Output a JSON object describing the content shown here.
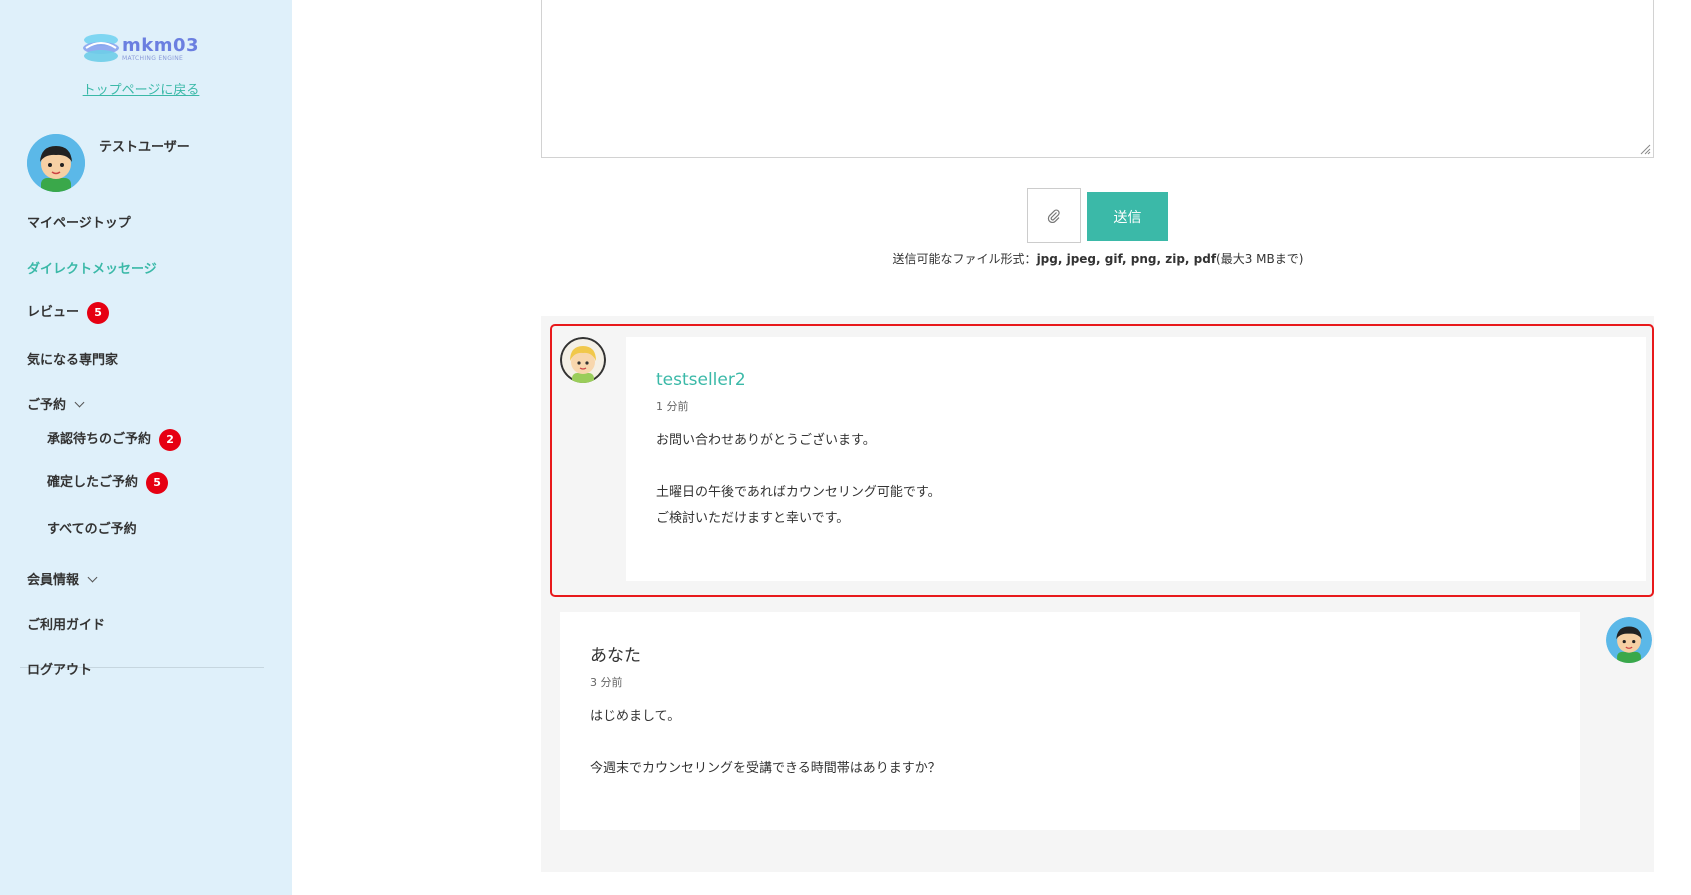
{
  "sidebar": {
    "logo_text": "mkm03",
    "logo_sub": "MATCHING ENGINE",
    "back_link": "トップページに戻る",
    "user_name": "テストユーザー",
    "items": {
      "mypage_top": "マイページトップ",
      "direct_message": "ダイレクトメッセージ",
      "review": "レビュー",
      "review_badge": "5",
      "favorites": "気になる専門家",
      "reservations": "ご予約",
      "pending": "承認待ちのご予約",
      "pending_badge": "2",
      "confirmed": "確定したご予約",
      "confirmed_badge": "5",
      "all_reservations": "すべてのご予約",
      "member_info": "会員情報",
      "guide": "ご利用ガイド",
      "logout": "ログアウト"
    }
  },
  "composer": {
    "textarea_value": "",
    "attach_icon": "paperclip-icon",
    "send_label": "送信",
    "file_note_prefix": "送信可能なファイル形式：",
    "file_note_formats": "jpg, jpeg, gif, png, zip, pdf",
    "file_note_limit": "(最大3 MBまで)"
  },
  "messages": [
    {
      "sender": "testseller2",
      "time": "1 分前",
      "lines": [
        "お問い合わせありがとうございます。",
        "",
        "土曜日の午後であればカウンセリング可能です。",
        "ご検討いただけますと幸いです。"
      ]
    },
    {
      "sender": "あなた",
      "time": "3 分前",
      "lines": [
        "はじめまして。",
        "",
        "今週末でカウンセリングを受講できる時間帯はありますか？"
      ]
    }
  ],
  "colors": {
    "accent": "#3bb9a8",
    "sidebar_bg": "#dff0fa",
    "badge": "#e60012",
    "highlight": "#e8191b"
  }
}
